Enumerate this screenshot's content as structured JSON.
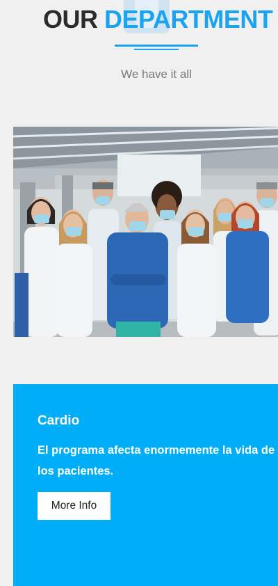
{
  "header": {
    "title_part1": "OUR",
    "title_part2": "DEPARTMENT",
    "subtitle": "We have it all",
    "accent_color": "#1aa3ef"
  },
  "photo": {
    "icon": "team-photo"
  },
  "card": {
    "title": "Cardio",
    "description": "El programa afecta enormemente la vida de los pacientes.",
    "button_label": "More Info",
    "background_color": "#00adf6"
  }
}
